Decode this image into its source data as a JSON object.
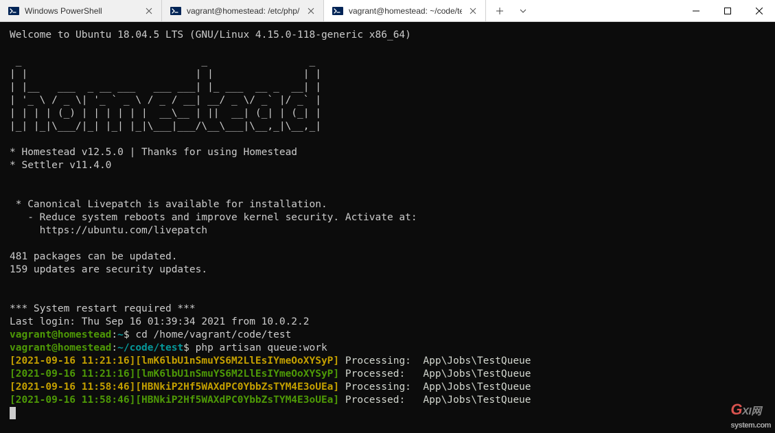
{
  "tabs": [
    {
      "title": "Windows PowerShell"
    },
    {
      "title": "vagrant@homestead: /etc/php/"
    },
    {
      "title": "vagrant@homestead: ~/code/te"
    }
  ],
  "terminal": {
    "welcome": "Welcome to Ubuntu 18.04.5 LTS (GNU/Linux 4.15.0-118-generic x86_64)",
    "ascii0": " _                              _                 _",
    "ascii1": "| |                            | |               | |",
    "ascii2": "| |__   ___  _ __ ___   ___ ___| |_ ___  __ _  __| |",
    "ascii3": "| '_ \\ / _ \\| '_ ` _ \\ / _ / __| __/ _ \\/ _` |/ _` |",
    "ascii4": "| | | | (_) | | | | | |  __\\__ | ||  __| (_| | (_| |",
    "ascii5": "|_| |_|\\___/|_| |_| |_|\\___|___/\\__\\___|\\__,_|\\__,_|",
    "homestead": "* Homestead v12.5.0 | Thanks for using Homestead",
    "settler": "* Settler v11.4.0",
    "livepatch1": " * Canonical Livepatch is available for installation.",
    "livepatch2": "   - Reduce system reboots and improve kernel security. Activate at:",
    "livepatch3": "     https://ubuntu.com/livepatch",
    "pkg1": "481 packages can be updated.",
    "pkg2": "159 updates are security updates.",
    "restart": "*** System restart required ***",
    "lastlogin": "Last login: Thu Sep 16 01:39:34 2021 from 10.0.2.2",
    "prompt1": {
      "user": "vagrant@homestead",
      "colon": ":",
      "path": "~",
      "dollar": "$ ",
      "cmd": "cd /home/vagrant/code/test"
    },
    "prompt2": {
      "user": "vagrant@homestead",
      "colon": ":",
      "path": "~/code/test",
      "dollar": "$ ",
      "cmd": "php artisan queue:work"
    },
    "q1": {
      "ts": "[2021-09-16 11:21:16][lmK6lbU1nSmuYS6M2LlEsIYmeOoXYSyP]",
      "status": "Processing:",
      "job": "App\\Jobs\\TestQueue"
    },
    "q2": {
      "ts": "[2021-09-16 11:21:16][lmK6lbU1nSmuYS6M2LlEsIYmeOoXYSyP]",
      "status": "Processed: ",
      "job": "App\\Jobs\\TestQueue"
    },
    "q3": {
      "ts": "[2021-09-16 11:58:46][HBNkiP2Hf5WAXdPC0YbbZsTYM4E3oUEa]",
      "status": "Processing:",
      "job": "App\\Jobs\\TestQueue"
    },
    "q4": {
      "ts": "[2021-09-16 11:58:46][HBNkiP2Hf5WAXdPC0YbbZsTYM4E3oUEa]",
      "status": "Processed: ",
      "job": "App\\Jobs\\TestQueue"
    }
  },
  "watermark": {
    "g": "G",
    "xi": "XI",
    "w": "网",
    "rest": "system.com"
  }
}
